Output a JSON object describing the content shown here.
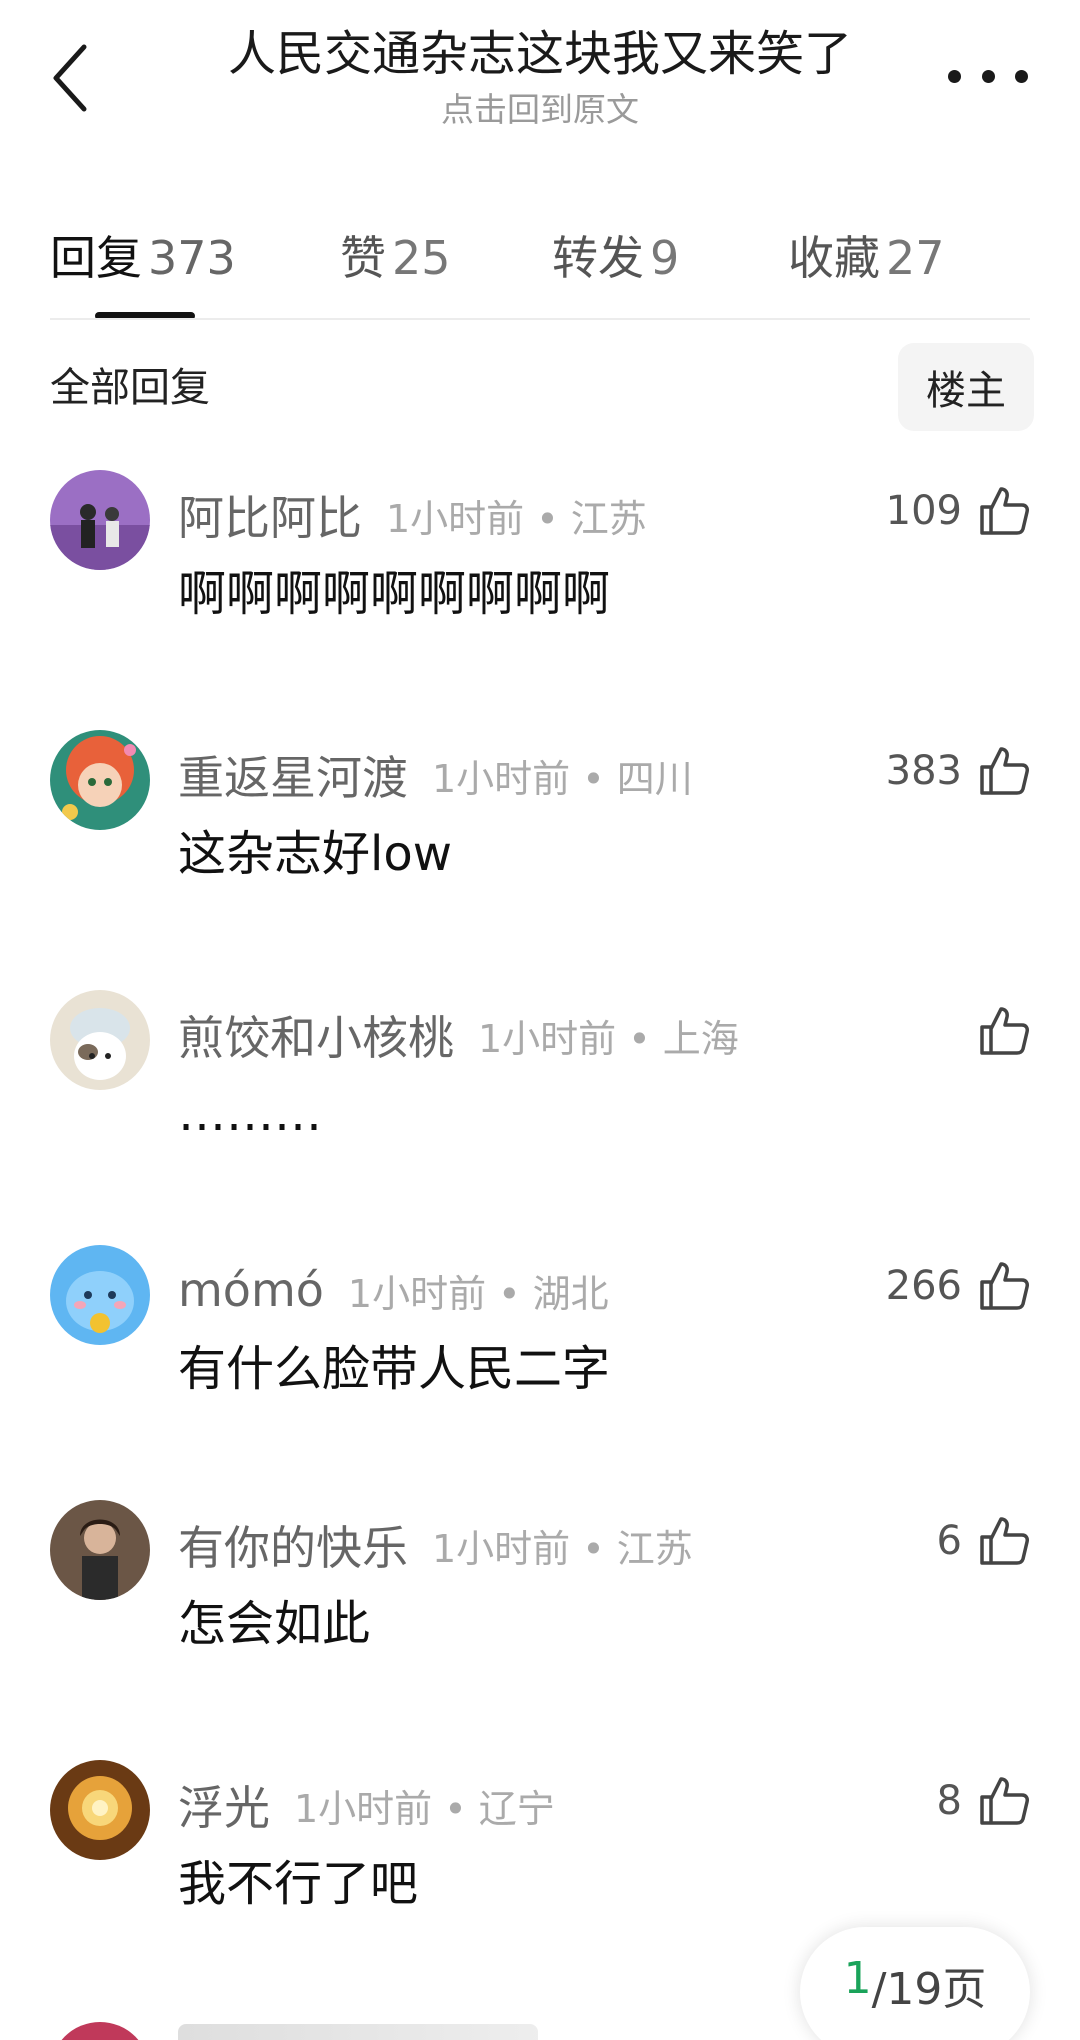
{
  "header": {
    "title": "人民交通杂志这块我又来笑了",
    "subtitle": "点击回到原文"
  },
  "tabs": [
    {
      "label": "回复",
      "count": "373",
      "active": true
    },
    {
      "label": "赞",
      "count": "25",
      "active": false
    },
    {
      "label": "转发",
      "count": "9",
      "active": false
    },
    {
      "label": "收藏",
      "count": "27",
      "active": false
    }
  ],
  "section": {
    "label": "全部回复",
    "owner_button": "楼主"
  },
  "comments": [
    {
      "name": "阿比阿比",
      "time": "1小时前 • 江苏",
      "likes": "109",
      "text": "啊啊啊啊啊啊啊啊啊",
      "avatar_color": "#8a5fb0"
    },
    {
      "name": "重返星河渡",
      "time": "1小时前 • 四川",
      "likes": "383",
      "text": "这杂志好low",
      "avatar_color": "#e07a4f"
    },
    {
      "name": "煎饺和小核桃",
      "time": "1小时前 • 上海",
      "likes": "",
      "text": "………",
      "avatar_color": "#c9b79a"
    },
    {
      "name": "mómó",
      "time": "1小时前 • 湖北",
      "likes": "266",
      "text": "有什么脸带人民二字",
      "avatar_color": "#4aa6f0"
    },
    {
      "name": "有你的快乐",
      "time": "1小时前 • 江苏",
      "likes": "6",
      "text": "怎会如此",
      "avatar_color": "#5a4636"
    },
    {
      "name": "浮光",
      "time": "1小时前 • 辽宁",
      "likes": "8",
      "text": "我不行了吧",
      "avatar_color": "#c98a2e"
    }
  ],
  "pager": {
    "current": "1",
    "rest": "/19页"
  },
  "icons": {
    "back": "chevron-left-icon",
    "more": "more-dots-icon",
    "like": "thumbs-up-icon"
  },
  "colors": {
    "accent_green": "#1aa35a",
    "muted_text": "#aaaaaa"
  }
}
